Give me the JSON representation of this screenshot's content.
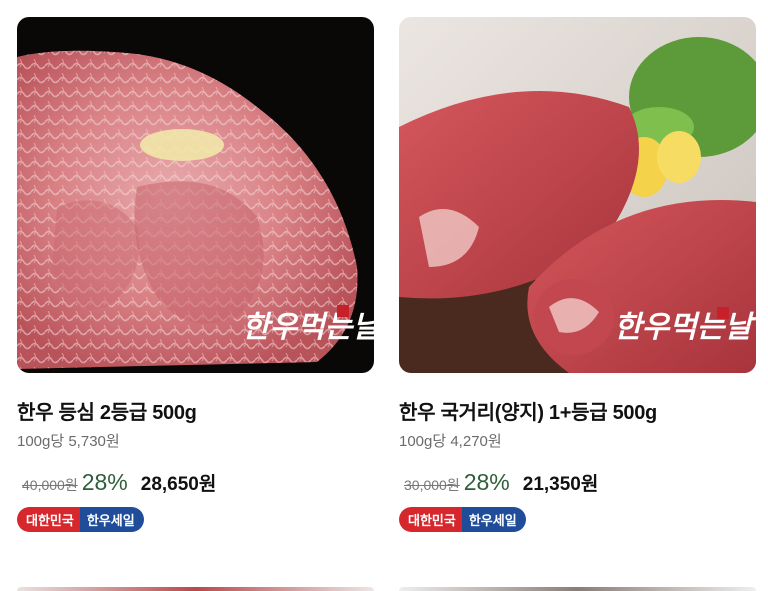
{
  "products": [
    {
      "name": "한우 등심 2등급 500g",
      "unit_price": "100g당 5,730원",
      "original_price": "40,000원",
      "discount_rate": "28%",
      "final_price": "28,650원",
      "badge": {
        "left": "대한민국",
        "right": "한우세일"
      },
      "image_icon": "beef-sirloin-photo",
      "image_watermark": "한우먹는날"
    },
    {
      "name": "한우 국거리(양지) 1+등급 500g",
      "unit_price": "100g당 4,270원",
      "original_price": "30,000원",
      "discount_rate": "28%",
      "final_price": "21,350원",
      "badge": {
        "left": "대한민국",
        "right": "한우세일"
      },
      "image_icon": "beef-brisket-photo",
      "image_watermark": "한우먹는날"
    }
  ],
  "colors": {
    "discount": "#2f5f3a",
    "badge_red": "#d6282c",
    "badge_blue": "#1f4d9a",
    "unit_text": "#6b6b6b"
  }
}
